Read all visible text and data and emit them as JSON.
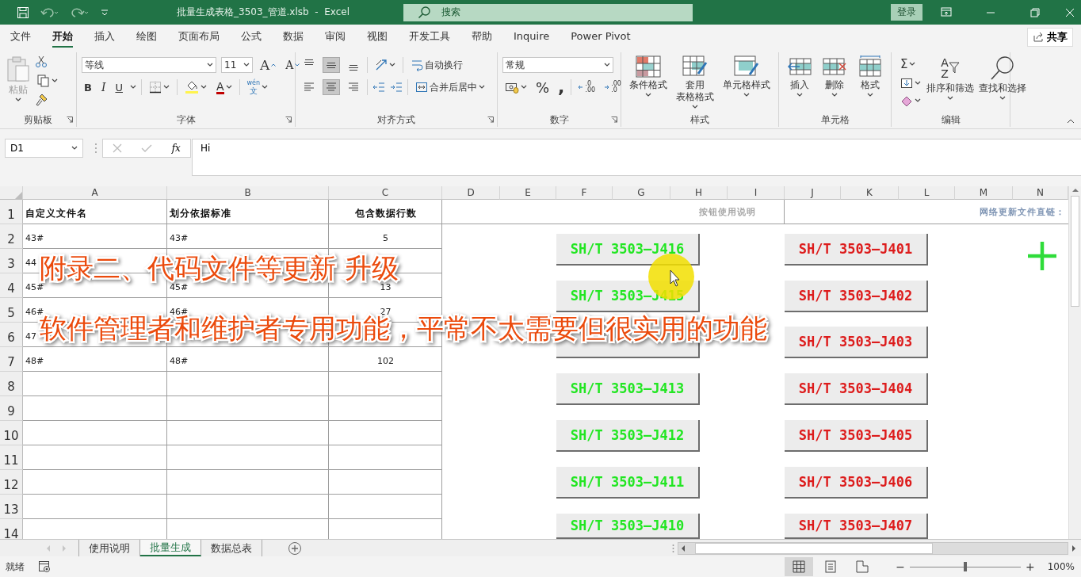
{
  "window": {
    "title": "批量生成表格_3503_管道.xlsb  -  Excel",
    "search": {
      "placeholder": "搜索"
    },
    "sign_in": "登录"
  },
  "menu_tabs": [
    {
      "label": "文件",
      "selected": false
    },
    {
      "label": "开始",
      "selected": true
    },
    {
      "label": "插入",
      "selected": false
    },
    {
      "label": "绘图",
      "selected": false
    },
    {
      "label": "页面布局",
      "selected": false
    },
    {
      "label": "公式",
      "selected": false
    },
    {
      "label": "数据",
      "selected": false
    },
    {
      "label": "审阅",
      "selected": false
    },
    {
      "label": "视图",
      "selected": false
    },
    {
      "label": "开发工具",
      "selected": false
    },
    {
      "label": "帮助",
      "selected": false
    },
    {
      "label": "Inquire",
      "selected": false
    },
    {
      "label": "Power Pivot",
      "selected": false
    }
  ],
  "share": "共享",
  "ribbon": {
    "clipboard": {
      "label": "剪贴板",
      "paste": {
        "label": "粘贴",
        "disabled": true
      }
    },
    "font": {
      "label": "字体",
      "font": "等线",
      "size": "11",
      "grow": "A",
      "shrink": "A",
      "bold": "B",
      "italic": "I",
      "underline": "U",
      "font_color": "A",
      "phonetic": [
        "wén",
        "文"
      ]
    },
    "alignment": {
      "label": "对齐方式",
      "vertical": [
        {
          "selected": false
        },
        {
          "selected": true
        },
        {
          "selected": false
        }
      ],
      "horizontal": [
        {
          "selected": false
        },
        {
          "selected": true
        },
        {
          "selected": false
        }
      ],
      "wrap": "自动换行",
      "merge": "合并后居中"
    },
    "number": {
      "label": "数字",
      "format": "常规",
      "percent": "%",
      "comma": ",",
      "increase_decimal": [
        ".0",
        ".00"
      ],
      "decrease_decimal": [
        ".00",
        ".0"
      ]
    },
    "styles": {
      "label": "样式",
      "buttons": [
        [
          "条件格式"
        ],
        [
          "套用",
          "表格格式"
        ],
        [
          "单元格样式"
        ]
      ]
    },
    "cells": {
      "label": "单元格",
      "buttons": [
        [
          "插入"
        ],
        [
          "删除"
        ],
        [
          "格式"
        ]
      ]
    },
    "editing": {
      "label": "编辑",
      "sum": "Σ",
      "sort_letters": [
        "A",
        "Z"
      ],
      "buttons": [
        [
          "排序和筛选"
        ],
        [
          "查找和选择"
        ]
      ]
    }
  },
  "formula_bar": {
    "name_box": "D1",
    "function_label": "fx",
    "value": "Hi"
  },
  "sheet": {
    "columns": [
      "A",
      "B",
      "C",
      "D",
      "E",
      "F",
      "G",
      "H",
      "I",
      "J",
      "K",
      "L",
      "M",
      "N"
    ],
    "header_row": {
      "number": "1",
      "cells": [
        "自定义文件名",
        "划分依据标准",
        "包含数据行数"
      ],
      "help": "按钮使用说明",
      "link_label": "网络更新文件直链："
    },
    "rows": [
      {
        "number": "2",
        "a": "43#",
        "b": "43#",
        "c": "5"
      },
      {
        "number": "3",
        "a": "44"
      },
      {
        "number": "4",
        "a": "45#",
        "b": "45#",
        "c": "13"
      },
      {
        "number": "5",
        "a": "46#",
        "b": "46#",
        "c": "27"
      },
      {
        "number": "6",
        "a": "47"
      },
      {
        "number": "7",
        "a": "48#",
        "b": "48#",
        "c": "102"
      },
      {
        "number": "8"
      },
      {
        "number": "9"
      },
      {
        "number": "10"
      },
      {
        "number": "11"
      },
      {
        "number": "12"
      },
      {
        "number": "13"
      },
      {
        "number": "14"
      }
    ],
    "button_columns": [
      [
        {
          "label": "SH/T 3503—J416",
          "color": "#22e622"
        },
        {
          "label": "SH/T 3503—J415",
          "color": "#22e622"
        },
        {},
        {
          "label": "SH/T 3503—J413",
          "color": "#22e622"
        },
        {
          "label": "SH/T 3503—J412",
          "color": "#22e622"
        },
        {
          "label": "SH/T 3503—J411",
          "color": "#22e622"
        },
        {
          "label": "SH/T 3503—J410",
          "color": "#22e622"
        }
      ],
      [
        {
          "label": "SH/T 3503—J401",
          "color": "#dd1c1c"
        },
        {
          "label": "SH/T 3503—J402",
          "color": "#dd1c1c"
        },
        {
          "label": "SH/T 3503—J403",
          "color": "#dd1c1c"
        },
        {
          "label": "SH/T 3503—J404",
          "color": "#dd1c1c"
        },
        {
          "label": "SH/T 3503—J405",
          "color": "#dd1c1c"
        },
        {
          "label": "SH/T 3503—J406",
          "color": "#dd1c1c"
        },
        {
          "label": "SH/T 3503—J407",
          "color": "#dd1c1c"
        }
      ]
    ]
  },
  "caption": [
    "附录二、代码文件等更新 升级",
    "软件管理者和维护者专用功能，平常不太需要但很实用的功能"
  ],
  "sheet_tabs": [
    {
      "label": "使用说明",
      "selected": false
    },
    {
      "label": "批量生成",
      "selected": true
    },
    {
      "label": "数据总表",
      "selected": false
    }
  ],
  "status_bar": {
    "status": "就绪",
    "views": [
      {
        "selected": true
      },
      {
        "selected": false
      },
      {
        "selected": false
      }
    ],
    "zoom": {
      "minus": "−",
      "plus": "+",
      "level": 0.5,
      "reading": "100%"
    }
  }
}
